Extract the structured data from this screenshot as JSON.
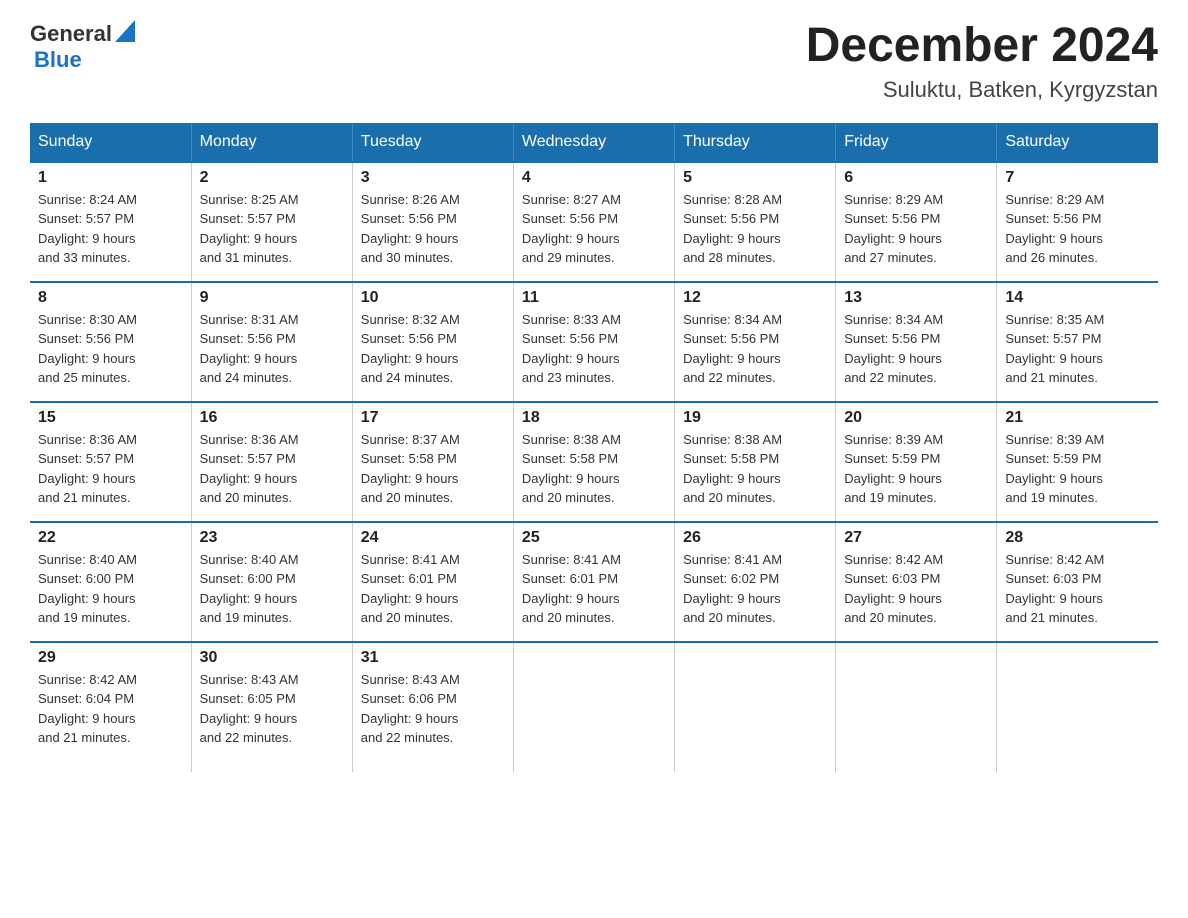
{
  "header": {
    "logo_general": "General",
    "logo_blue": "Blue",
    "month_title": "December 2024",
    "location": "Suluktu, Batken, Kyrgyzstan"
  },
  "weekdays": [
    "Sunday",
    "Monday",
    "Tuesday",
    "Wednesday",
    "Thursday",
    "Friday",
    "Saturday"
  ],
  "weeks": [
    [
      {
        "day": "1",
        "sunrise": "8:24 AM",
        "sunset": "5:57 PM",
        "daylight": "9 hours and 33 minutes."
      },
      {
        "day": "2",
        "sunrise": "8:25 AM",
        "sunset": "5:57 PM",
        "daylight": "9 hours and 31 minutes."
      },
      {
        "day": "3",
        "sunrise": "8:26 AM",
        "sunset": "5:56 PM",
        "daylight": "9 hours and 30 minutes."
      },
      {
        "day": "4",
        "sunrise": "8:27 AM",
        "sunset": "5:56 PM",
        "daylight": "9 hours and 29 minutes."
      },
      {
        "day": "5",
        "sunrise": "8:28 AM",
        "sunset": "5:56 PM",
        "daylight": "9 hours and 28 minutes."
      },
      {
        "day": "6",
        "sunrise": "8:29 AM",
        "sunset": "5:56 PM",
        "daylight": "9 hours and 27 minutes."
      },
      {
        "day": "7",
        "sunrise": "8:29 AM",
        "sunset": "5:56 PM",
        "daylight": "9 hours and 26 minutes."
      }
    ],
    [
      {
        "day": "8",
        "sunrise": "8:30 AM",
        "sunset": "5:56 PM",
        "daylight": "9 hours and 25 minutes."
      },
      {
        "day": "9",
        "sunrise": "8:31 AM",
        "sunset": "5:56 PM",
        "daylight": "9 hours and 24 minutes."
      },
      {
        "day": "10",
        "sunrise": "8:32 AM",
        "sunset": "5:56 PM",
        "daylight": "9 hours and 24 minutes."
      },
      {
        "day": "11",
        "sunrise": "8:33 AM",
        "sunset": "5:56 PM",
        "daylight": "9 hours and 23 minutes."
      },
      {
        "day": "12",
        "sunrise": "8:34 AM",
        "sunset": "5:56 PM",
        "daylight": "9 hours and 22 minutes."
      },
      {
        "day": "13",
        "sunrise": "8:34 AM",
        "sunset": "5:56 PM",
        "daylight": "9 hours and 22 minutes."
      },
      {
        "day": "14",
        "sunrise": "8:35 AM",
        "sunset": "5:57 PM",
        "daylight": "9 hours and 21 minutes."
      }
    ],
    [
      {
        "day": "15",
        "sunrise": "8:36 AM",
        "sunset": "5:57 PM",
        "daylight": "9 hours and 21 minutes."
      },
      {
        "day": "16",
        "sunrise": "8:36 AM",
        "sunset": "5:57 PM",
        "daylight": "9 hours and 20 minutes."
      },
      {
        "day": "17",
        "sunrise": "8:37 AM",
        "sunset": "5:58 PM",
        "daylight": "9 hours and 20 minutes."
      },
      {
        "day": "18",
        "sunrise": "8:38 AM",
        "sunset": "5:58 PM",
        "daylight": "9 hours and 20 minutes."
      },
      {
        "day": "19",
        "sunrise": "8:38 AM",
        "sunset": "5:58 PM",
        "daylight": "9 hours and 20 minutes."
      },
      {
        "day": "20",
        "sunrise": "8:39 AM",
        "sunset": "5:59 PM",
        "daylight": "9 hours and 19 minutes."
      },
      {
        "day": "21",
        "sunrise": "8:39 AM",
        "sunset": "5:59 PM",
        "daylight": "9 hours and 19 minutes."
      }
    ],
    [
      {
        "day": "22",
        "sunrise": "8:40 AM",
        "sunset": "6:00 PM",
        "daylight": "9 hours and 19 minutes."
      },
      {
        "day": "23",
        "sunrise": "8:40 AM",
        "sunset": "6:00 PM",
        "daylight": "9 hours and 19 minutes."
      },
      {
        "day": "24",
        "sunrise": "8:41 AM",
        "sunset": "6:01 PM",
        "daylight": "9 hours and 20 minutes."
      },
      {
        "day": "25",
        "sunrise": "8:41 AM",
        "sunset": "6:01 PM",
        "daylight": "9 hours and 20 minutes."
      },
      {
        "day": "26",
        "sunrise": "8:41 AM",
        "sunset": "6:02 PM",
        "daylight": "9 hours and 20 minutes."
      },
      {
        "day": "27",
        "sunrise": "8:42 AM",
        "sunset": "6:03 PM",
        "daylight": "9 hours and 20 minutes."
      },
      {
        "day": "28",
        "sunrise": "8:42 AM",
        "sunset": "6:03 PM",
        "daylight": "9 hours and 21 minutes."
      }
    ],
    [
      {
        "day": "29",
        "sunrise": "8:42 AM",
        "sunset": "6:04 PM",
        "daylight": "9 hours and 21 minutes."
      },
      {
        "day": "30",
        "sunrise": "8:43 AM",
        "sunset": "6:05 PM",
        "daylight": "9 hours and 22 minutes."
      },
      {
        "day": "31",
        "sunrise": "8:43 AM",
        "sunset": "6:06 PM",
        "daylight": "9 hours and 22 minutes."
      },
      null,
      null,
      null,
      null
    ]
  ],
  "labels": {
    "sunrise": "Sunrise:",
    "sunset": "Sunset:",
    "daylight": "Daylight:"
  }
}
